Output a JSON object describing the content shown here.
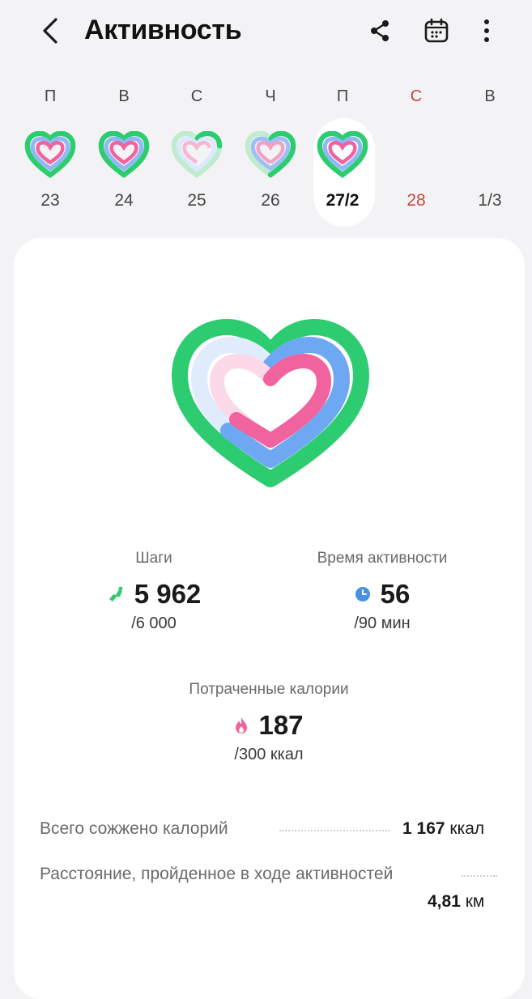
{
  "header": {
    "title": "Активность",
    "back_icon": "chevron-left-icon",
    "share_icon": "share-icon",
    "calendar_icon": "calendar-icon",
    "more_icon": "more-vertical-icon"
  },
  "week": [
    {
      "letter": "П",
      "num": "23",
      "has_ring": true
    },
    {
      "letter": "В",
      "num": "24",
      "has_ring": true
    },
    {
      "letter": "С",
      "num": "25",
      "has_ring": true
    },
    {
      "letter": "Ч",
      "num": "26",
      "has_ring": true
    },
    {
      "letter": "П",
      "num": "27/2",
      "has_ring": true,
      "selected": true
    },
    {
      "letter": "С",
      "num": "28",
      "has_ring": false,
      "weekend": true
    },
    {
      "letter": "В",
      "num": "1/3",
      "has_ring": false
    }
  ],
  "colors": {
    "steps_ring": "#2ecc71",
    "active_ring": "#6fa8f2",
    "calories_ring": "#f0639e",
    "weekend": "#c9463d"
  },
  "stats": {
    "steps": {
      "label": "Шаги",
      "value": "5 962",
      "goal": "/6 000",
      "icon": "running-shoe-icon"
    },
    "active_time": {
      "label": "Время активности",
      "value": "56",
      "goal": "/90 мин",
      "icon": "clock-icon"
    },
    "calories": {
      "label": "Потраченные калории",
      "value": "187",
      "goal": "/300 ккал",
      "icon": "flame-icon"
    }
  },
  "summary": {
    "total_calories_label": "Всего сожжено калорий",
    "total_calories_value": "1 167",
    "total_calories_unit": "ккал",
    "distance_label": "Расстояние, пройденное в ходе активностей",
    "distance_value": "4,81",
    "distance_unit": "км"
  }
}
